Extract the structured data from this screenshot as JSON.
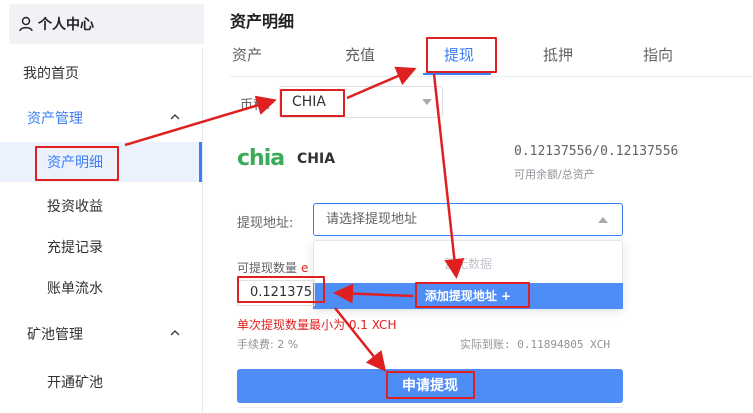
{
  "sidebar": {
    "header": "个人中心",
    "items": [
      {
        "label": "我的首页"
      },
      {
        "label": "资产管理"
      },
      {
        "label": "资产明细"
      },
      {
        "label": "投资收益"
      },
      {
        "label": "充提记录"
      },
      {
        "label": "账单流水"
      },
      {
        "label": "矿池管理"
      },
      {
        "label": "开通矿池"
      }
    ]
  },
  "main": {
    "title": "资产明细",
    "tabs": [
      {
        "label": "资产"
      },
      {
        "label": "充值"
      },
      {
        "label": "提现"
      },
      {
        "label": "抵押"
      },
      {
        "label": "指向"
      }
    ],
    "active_tab": "提现"
  },
  "form": {
    "coin_label": "币种:",
    "coin_value": "CHIA",
    "coin_logo_text": "chia",
    "coin_name": "CHIA",
    "balance": "0.12137556/0.12137556",
    "balance_caption": "可用余额/总资产",
    "address_label": "提现地址:",
    "address_placeholder": "请选择提现地址",
    "dropdown_empty": "暂无数据",
    "add_address_button": "添加提现地址 +",
    "amount_label": "可提现数量",
    "amount_value": "0.121375",
    "min_warning": "单次提现数量最小为 0.1 XCH",
    "fee": "手续费: 2 %",
    "actual_received": "实际到账: 0.11894805 XCH",
    "submit_button": "申请提现"
  },
  "colors": {
    "accent": "#3b7ef6",
    "annotation": "#e02020",
    "brand_green": "#3aac59"
  }
}
